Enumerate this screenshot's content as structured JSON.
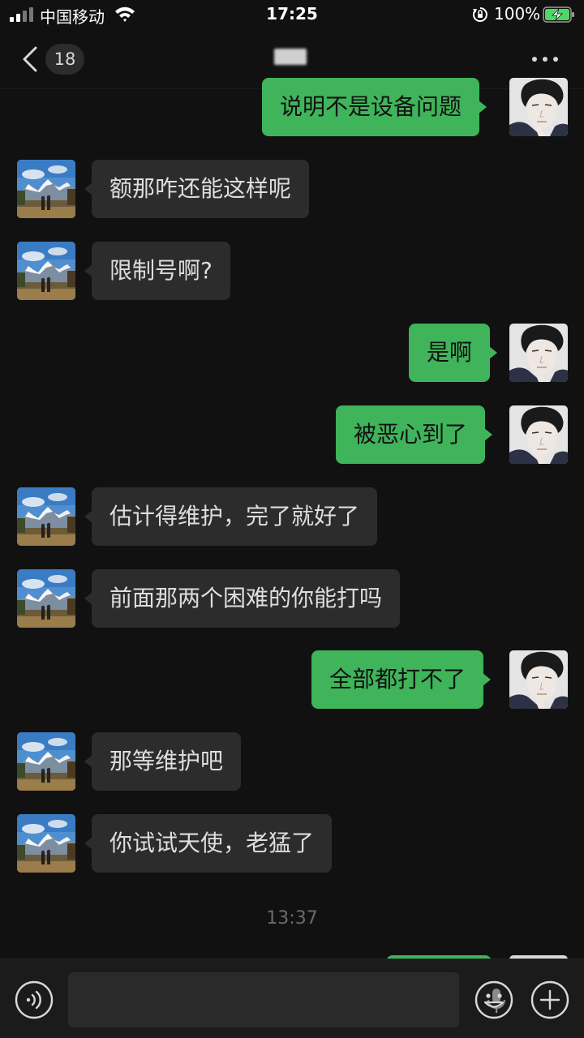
{
  "status_bar": {
    "carrier": "中国移动",
    "time": "17:25",
    "battery": "100%"
  },
  "nav": {
    "unread_count": "18",
    "title": ""
  },
  "messages": [
    {
      "side": "out",
      "text": "说明不是设备问题"
    },
    {
      "side": "in",
      "text": "额那咋还能这样呢"
    },
    {
      "side": "in",
      "text": "限制号啊?"
    },
    {
      "side": "out",
      "text": "是啊"
    },
    {
      "side": "out",
      "text": "被恶心到了"
    },
    {
      "side": "in",
      "text": "估计得维护，完了就好了"
    },
    {
      "side": "in",
      "text": "前面那两个困难的你能打吗"
    },
    {
      "side": "out",
      "text": "全部都打不了"
    },
    {
      "side": "in",
      "text": "那等维护吧"
    },
    {
      "side": "in",
      "text": "你试试天使，老猛了"
    }
  ],
  "timestamp": "13:37",
  "input": {
    "value": "",
    "placeholder": ""
  },
  "icons": {
    "back": "chevron-left-icon",
    "more": "more-dots-icon",
    "voice": "voice-icon",
    "mic": "mic-icon",
    "emoji": "emoji-icon",
    "plus": "plus-icon"
  },
  "colors": {
    "background": "#111111",
    "incoming_bubble": "#2c2c2c",
    "outgoing_bubble": "#3fb45a",
    "input_bar": "#1b1b1b"
  }
}
